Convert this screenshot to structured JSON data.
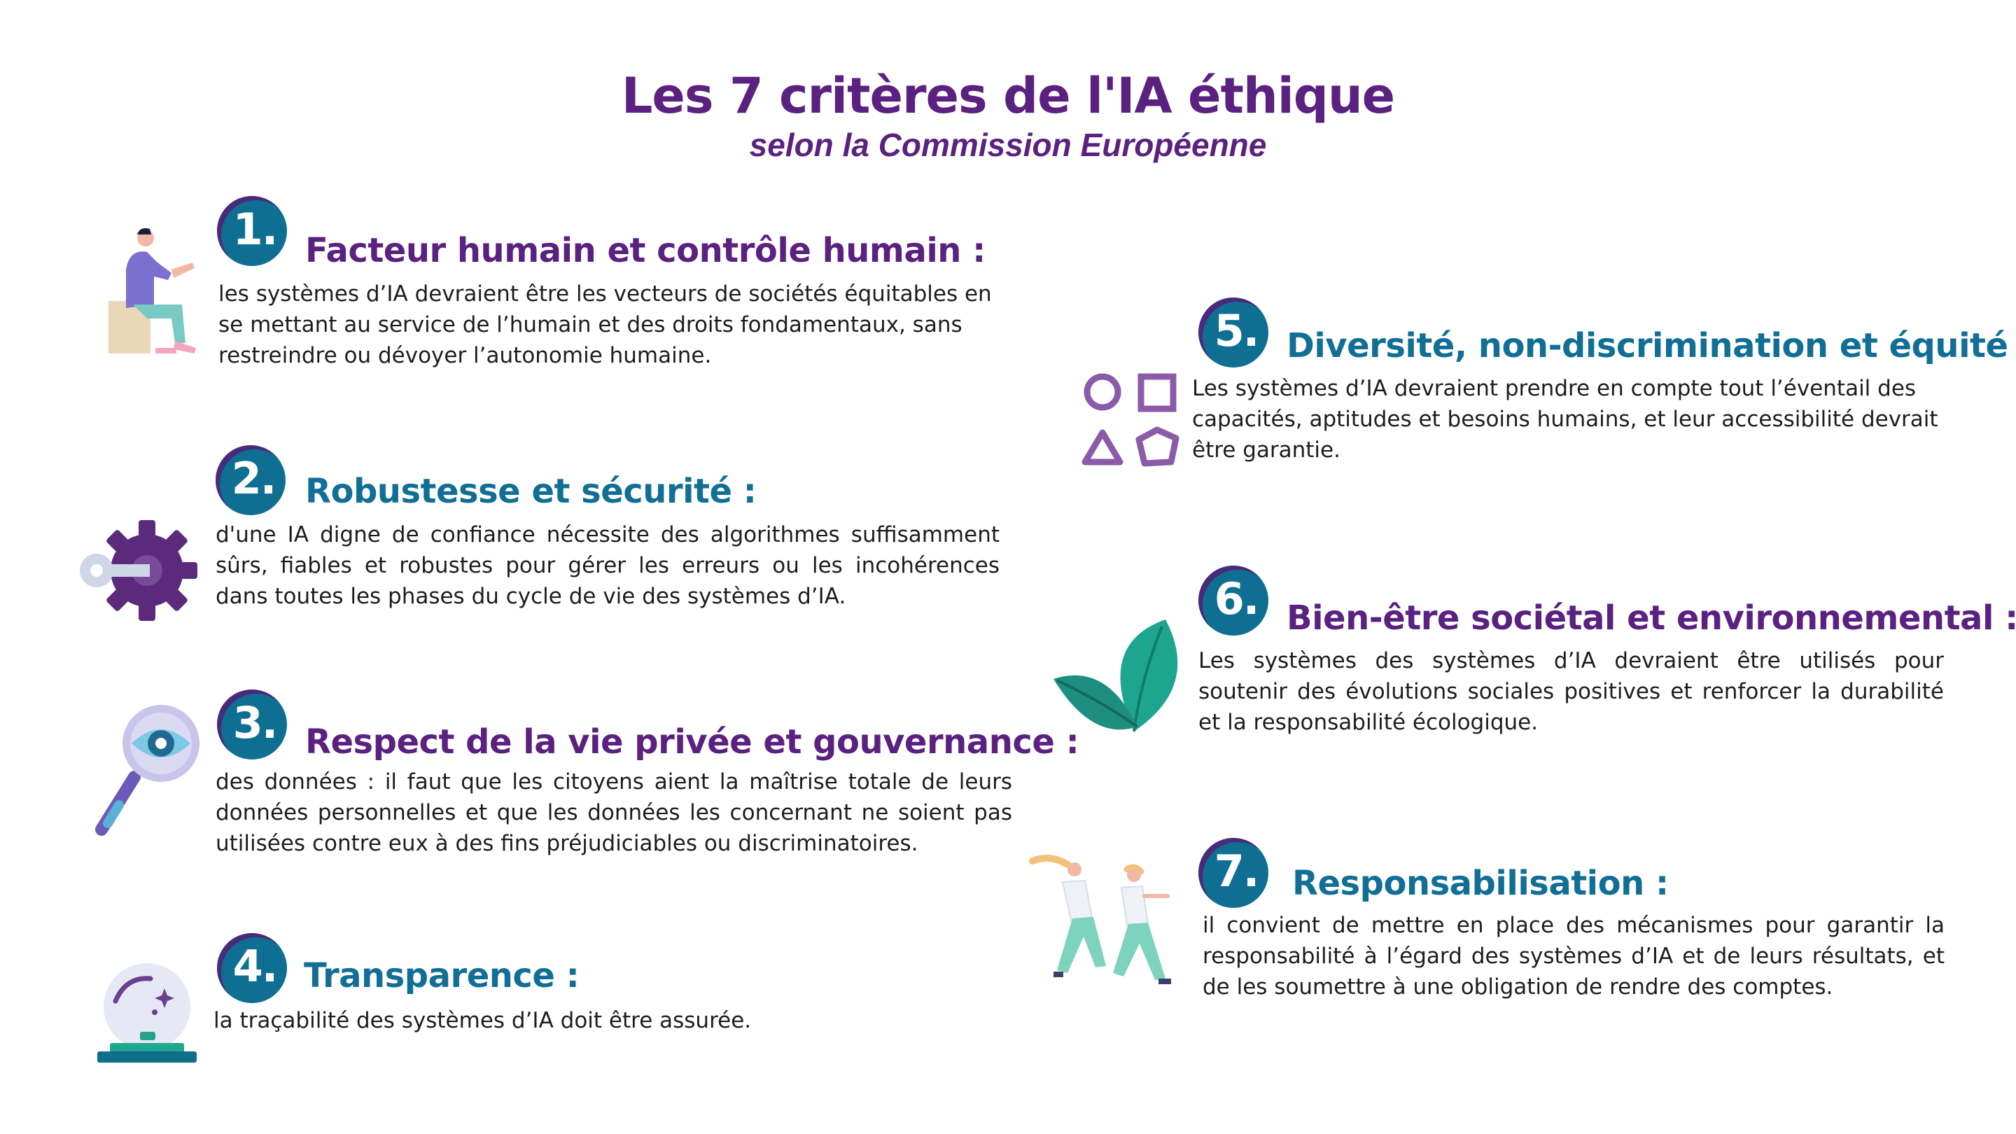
{
  "header": {
    "title": "Les 7 critères de l'IA éthique",
    "subtitle": "selon la Commission Européenne"
  },
  "colors": {
    "purple": "#5b2180",
    "teal": "#116f96",
    "badge": "#0e6f92"
  },
  "criteria": [
    {
      "number": "1.",
      "title": "Facteur humain et contrôle humain  :",
      "text": "les systèmes d’IA devraient être les vecteurs de sociétés équitables en se mettant au service de l’humain et des droits fondamentaux, sans restreindre ou dévoyer l’autonomie humaine.",
      "icon": "person-sitting-icon"
    },
    {
      "number": "2.",
      "title": "Robustesse et sécurité  :",
      "text": "d'une IA digne de confiance nécessite des algorithmes suffisamment sûrs, fiables et robustes pour gérer les erreurs ou les incohérences dans toutes les phases du cycle de vie des systèmes d’IA.",
      "icon": "gear-key-icon"
    },
    {
      "number": "3.",
      "title": "Respect de la vie privée et gouvernance :",
      "text": "des données : il faut que les citoyens aient la maîtrise totale de leurs données personnelles et que les données les concernant ne soient pas utilisées contre eux à des fins préjudiciables ou discriminatoires.",
      "icon": "magnifier-eye-icon"
    },
    {
      "number": "4.",
      "title": "Transparence :",
      "text": "la traçabilité des systèmes d’IA doit être assurée.",
      "icon": "crystal-ball-icon"
    },
    {
      "number": "5.",
      "title": "Diversité, non-discrimination et équité :",
      "text": "Les systèmes d’IA devraient prendre en compte tout l’éventail des capacités, aptitudes et besoins humains, et leur accessibilité devrait être garantie.",
      "icon": "shapes-icon"
    },
    {
      "number": "6.",
      "title": "Bien-être sociétal et environnemental :",
      "text": "Les systèmes des systèmes d’IA devraient être utilisés pour soutenir des évolutions sociales positives et renforcer la durabilité et la responsabilité écologique.",
      "icon": "leaves-icon"
    },
    {
      "number": "7.",
      "title": "Responsabilisation :",
      "text": "il convient de mettre en place des mécanismes pour garantir la responsabilité à l’égard des systèmes d’IA et de leurs résultats, et de les soumettre à une obligation de rendre des comptes.",
      "icon": "runners-icon"
    }
  ]
}
